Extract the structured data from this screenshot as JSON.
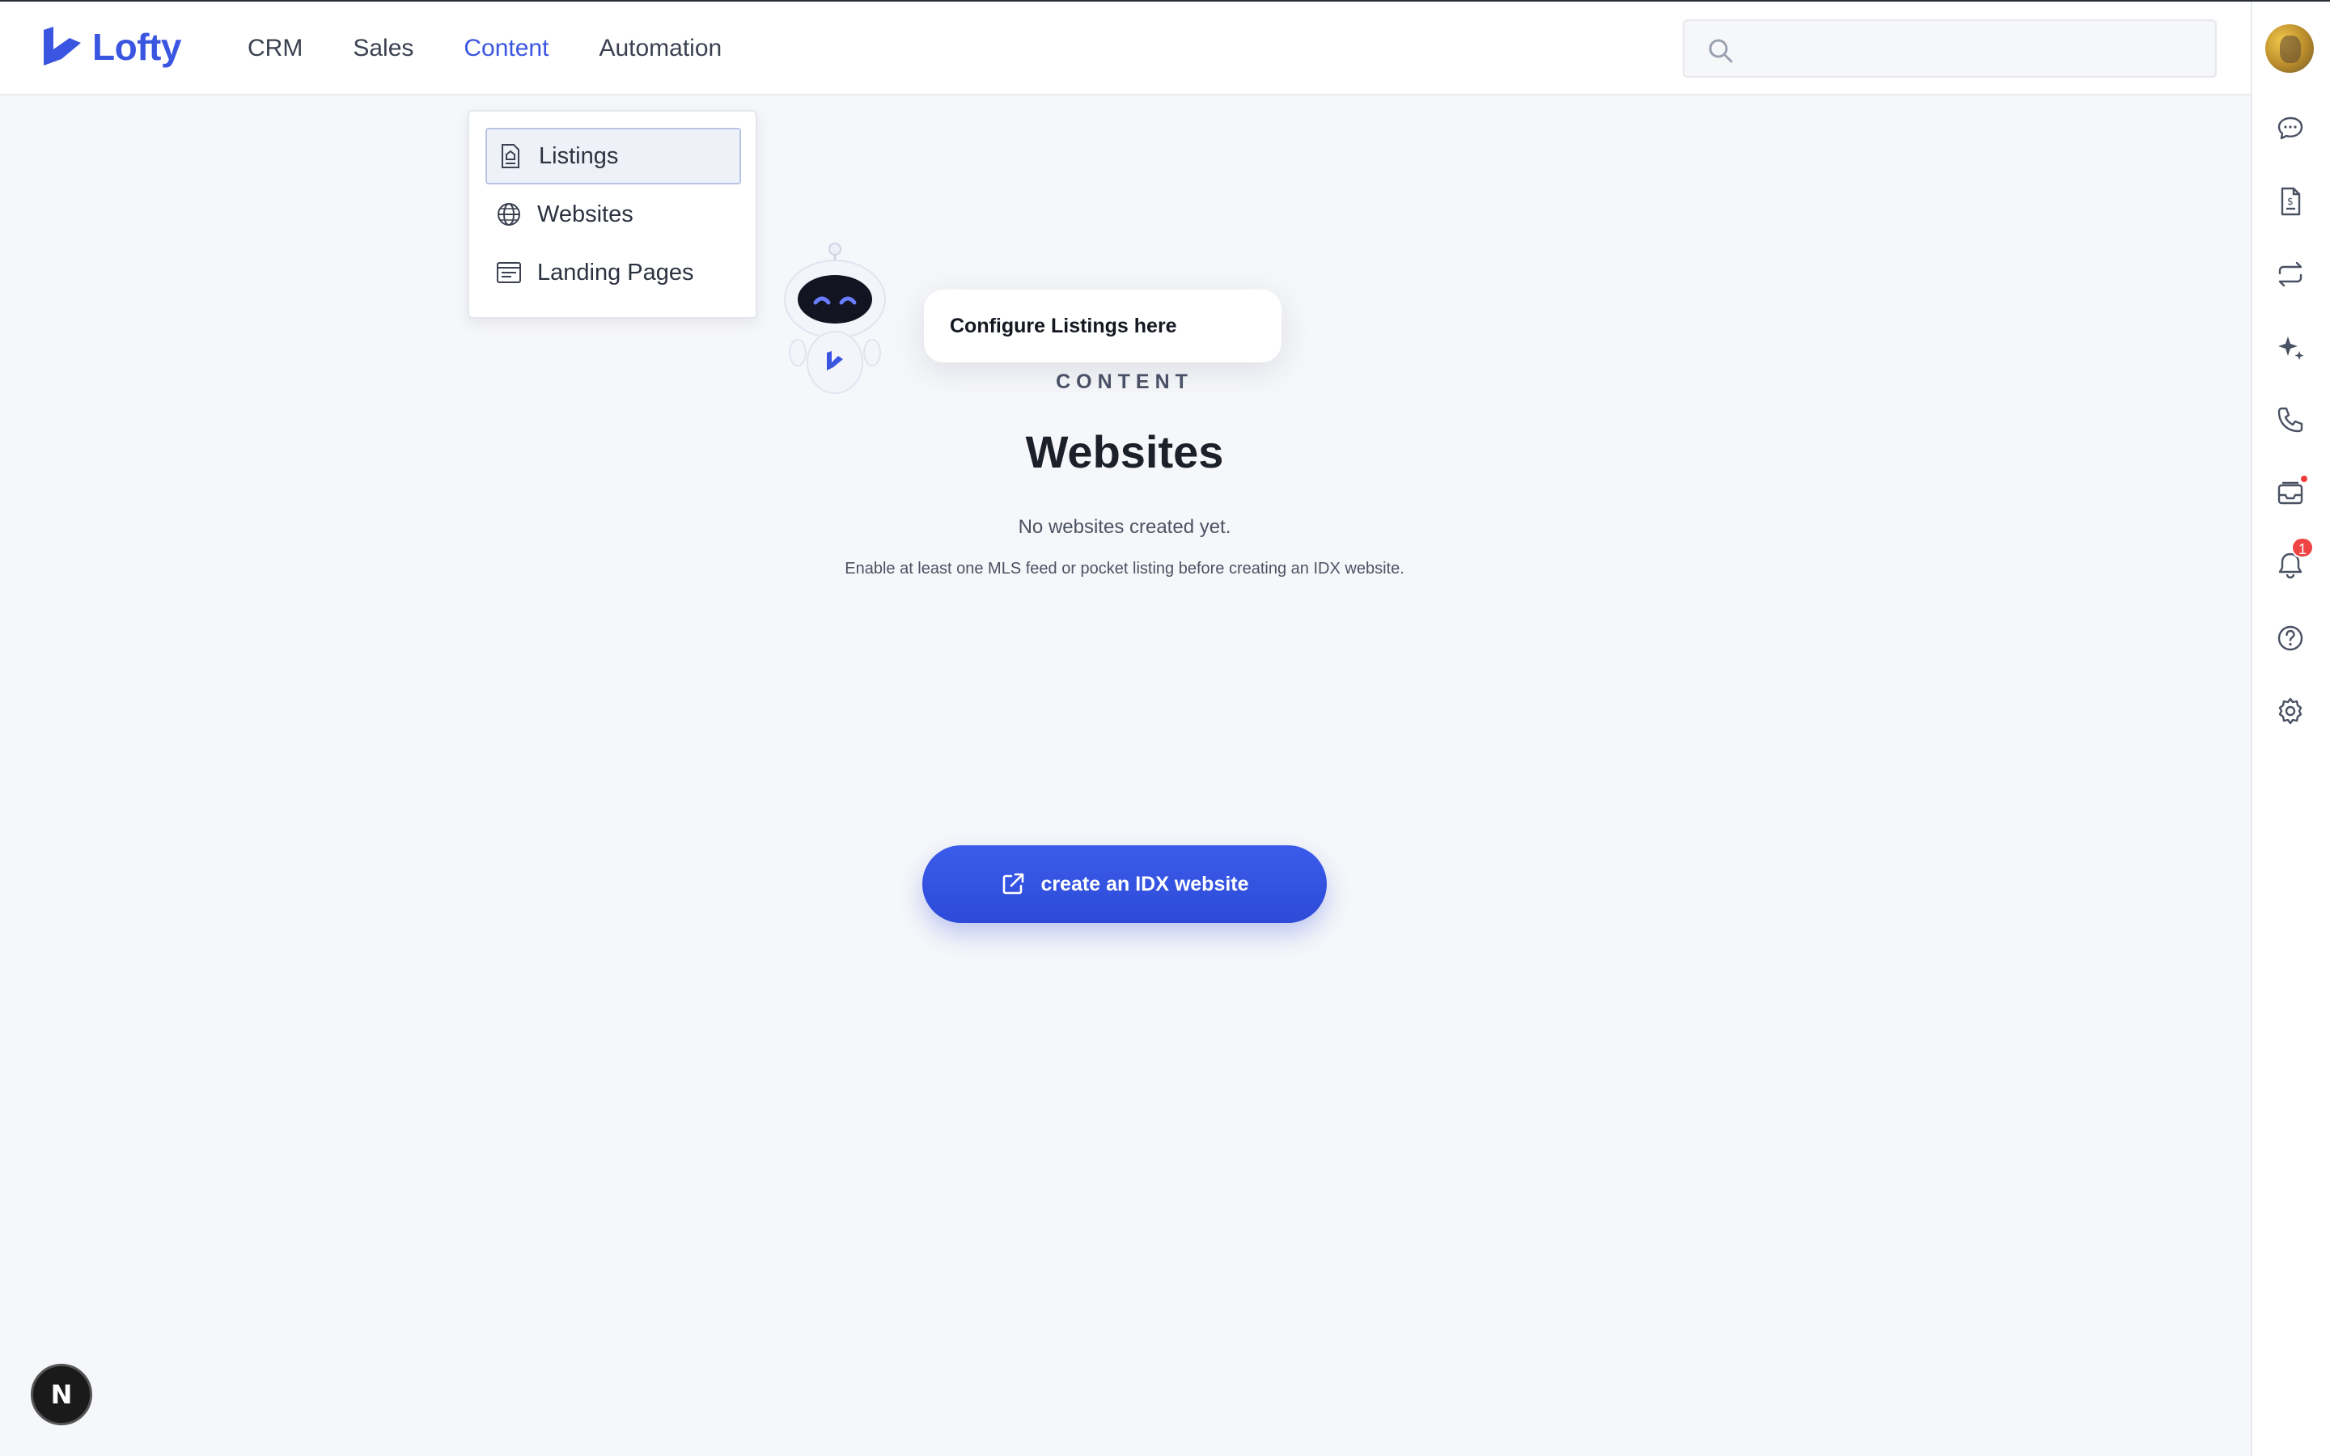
{
  "brand": {
    "name": "Lofty",
    "accent": "#3a55e0"
  },
  "nav": {
    "items": [
      {
        "label": "CRM"
      },
      {
        "label": "Sales"
      },
      {
        "label": "Content",
        "active": true
      },
      {
        "label": "Automation"
      }
    ]
  },
  "search": {
    "placeholder": ""
  },
  "dropdown": {
    "items": [
      {
        "label": "Listings",
        "icon": "listing-doc-icon",
        "selected": true
      },
      {
        "label": "Websites",
        "icon": "globe-icon"
      },
      {
        "label": "Landing Pages",
        "icon": "landing-page-icon"
      }
    ]
  },
  "assistant": {
    "tooltip": "Configure Listings here"
  },
  "main": {
    "section": "CONTENT",
    "title": "Websites",
    "empty_message": "No websites created yet.",
    "empty_hint": "Enable at least one MLS feed or pocket listing before creating an IDX website.",
    "cta_label": "create an IDX website",
    "cta_color": "#2d4bd8"
  },
  "rightbar": {
    "icons": [
      "chat-icon",
      "document-dollar-icon",
      "repeat-icon",
      "sparkle-icon",
      "phone-icon",
      "inbox-icon",
      "bell-icon",
      "help-icon",
      "settings-icon"
    ],
    "notification_count": "1"
  },
  "dev_badge": {
    "letter": "N"
  }
}
